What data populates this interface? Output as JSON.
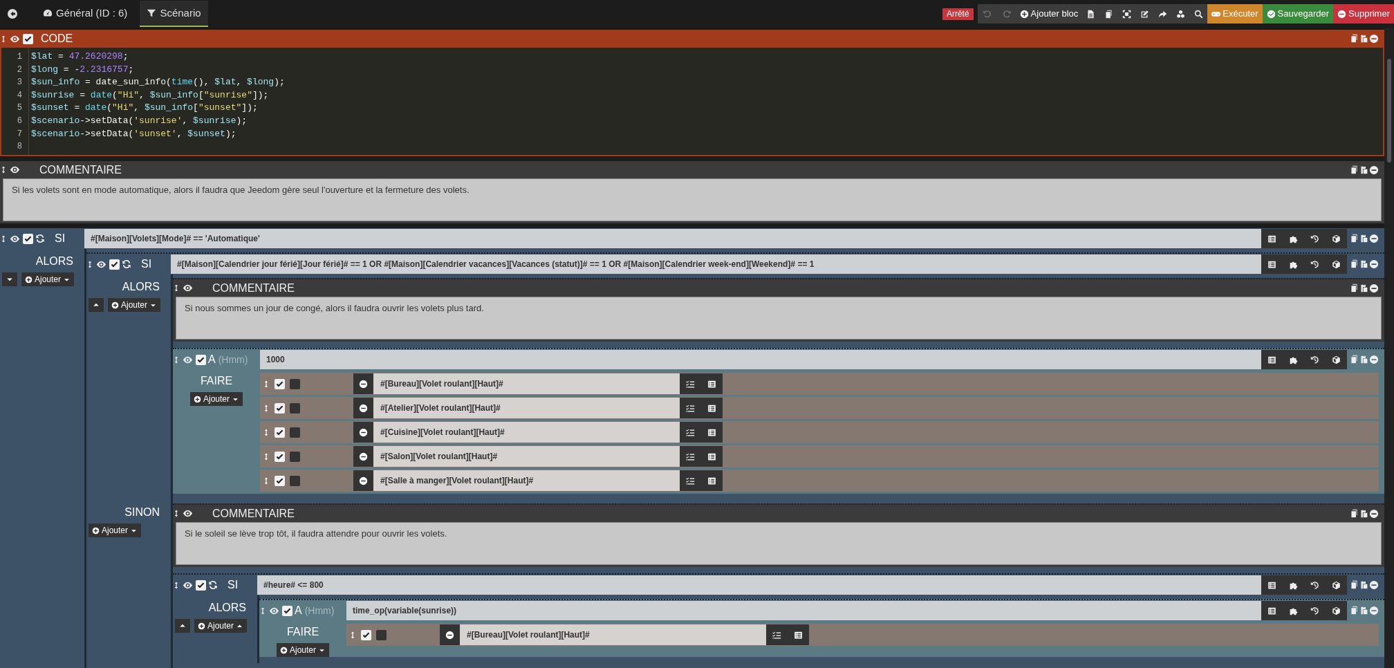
{
  "topbar": {
    "tabs": [
      {
        "label": "Général (ID : 6)",
        "selected": false
      },
      {
        "label": "Scénario",
        "selected": true
      }
    ],
    "status": {
      "label": "Arrêté"
    },
    "undo": {
      "disabled": true
    },
    "redo": {
      "disabled": true
    },
    "add_block": {
      "label": "Ajouter bloc"
    },
    "actions": [
      {
        "label": "Exécuter",
        "color": "#d0862a"
      },
      {
        "label": "Sauvegarder",
        "color": "#3a8b3c"
      },
      {
        "label": "Supprimer",
        "color": "#c9323d"
      }
    ]
  },
  "blocks": [
    {
      "kind": "code",
      "title": "CODE",
      "enabled": true,
      "lines": [
        {
          "number": "1",
          "tokens": [
            {
              "text": "$lat",
              "kind": "var"
            },
            {
              "text": " = ",
              "kind": "plain"
            },
            {
              "text": "47.2620298",
              "kind": "num"
            },
            {
              "text": ";",
              "kind": "plain"
            }
          ]
        },
        {
          "number": "2",
          "tokens": [
            {
              "text": "$long",
              "kind": "var"
            },
            {
              "text": " = -",
              "kind": "plain"
            },
            {
              "text": "2.2316757",
              "kind": "num"
            },
            {
              "text": ";",
              "kind": "plain"
            }
          ]
        },
        {
          "number": "3",
          "tokens": [
            {
              "text": "$sun_info",
              "kind": "var"
            },
            {
              "text": " = date_sun_info(",
              "kind": "plain"
            },
            {
              "text": "time",
              "kind": "fn"
            },
            {
              "text": "(), ",
              "kind": "plain"
            },
            {
              "text": "$lat",
              "kind": "var"
            },
            {
              "text": ", ",
              "kind": "plain"
            },
            {
              "text": "$long",
              "kind": "var"
            },
            {
              "text": ");",
              "kind": "plain"
            }
          ]
        },
        {
          "number": "4",
          "tokens": [
            {
              "text": "$sunrise",
              "kind": "var"
            },
            {
              "text": " = ",
              "kind": "plain"
            },
            {
              "text": "date",
              "kind": "fn"
            },
            {
              "text": "(",
              "kind": "plain"
            },
            {
              "text": "\"Hi\"",
              "kind": "str"
            },
            {
              "text": ", ",
              "kind": "plain"
            },
            {
              "text": "$sun_info",
              "kind": "var"
            },
            {
              "text": "[",
              "kind": "plain"
            },
            {
              "text": "\"sunrise\"",
              "kind": "str"
            },
            {
              "text": "]);",
              "kind": "plain"
            }
          ]
        },
        {
          "number": "5",
          "tokens": [
            {
              "text": "$sunset",
              "kind": "var"
            },
            {
              "text": " = ",
              "kind": "plain"
            },
            {
              "text": "date",
              "kind": "fn"
            },
            {
              "text": "(",
              "kind": "plain"
            },
            {
              "text": "\"Hi\"",
              "kind": "str"
            },
            {
              "text": ", ",
              "kind": "plain"
            },
            {
              "text": "$sun_info",
              "kind": "var"
            },
            {
              "text": "[",
              "kind": "plain"
            },
            {
              "text": "\"sunset\"",
              "kind": "str"
            },
            {
              "text": "]);",
              "kind": "plain"
            }
          ]
        },
        {
          "number": "6",
          "tokens": [
            {
              "text": "$scenario",
              "kind": "var"
            },
            {
              "text": "->setData(",
              "kind": "plain"
            },
            {
              "text": "'sunrise'",
              "kind": "str"
            },
            {
              "text": ", ",
              "kind": "plain"
            },
            {
              "text": "$sunrise",
              "kind": "var"
            },
            {
              "text": ");",
              "kind": "plain"
            }
          ]
        },
        {
          "number": "7",
          "tokens": [
            {
              "text": "$scenario",
              "kind": "var"
            },
            {
              "text": "->setData(",
              "kind": "plain"
            },
            {
              "text": "'sunset'",
              "kind": "str"
            },
            {
              "text": ", ",
              "kind": "plain"
            },
            {
              "text": "$sunset",
              "kind": "var"
            },
            {
              "text": ");",
              "kind": "plain"
            }
          ]
        },
        {
          "number": "8"
        }
      ]
    },
    {
      "kind": "comment",
      "title": "COMMENTAIRE",
      "text": "Si les volets sont en mode automatique, alors il faudra que Jeedom gère seul l'ouverture et la fermeture des volets."
    },
    {
      "kind": "if",
      "label": "SI",
      "enabled": true,
      "condition": "#[Maison][Volets][Mode]# == 'Automatique'",
      "branches": [
        {
          "label": "ALORS",
          "expanded": false,
          "add": {
            "label": "Ajouter",
            "menu_open": false
          },
          "children": [
            {
              "kind": "if",
              "label": "SI",
              "enabled": true,
              "condition": "#[Maison][Calendrier jour férié][Jour férié]# == 1 OR #[Maison][Calendrier vacances][Vacances (statut)]# == 1 OR #[Maison][Calendrier week-end][Weekend]# == 1",
              "branches": [
                {
                  "label": "ALORS",
                  "expanded": true,
                  "add": {
                    "label": "Ajouter",
                    "menu_open": false
                  },
                  "children": [
                    {
                      "kind": "comment",
                      "title": "COMMENTAIRE",
                      "text": "Si nous sommes un jour de congé, alors il faudra ouvrir les volets plus tard."
                    },
                    {
                      "kind": "at",
                      "label": "A",
                      "unit": "(Hmm)",
                      "enabled": true,
                      "value": "1000",
                      "section": "FAIRE",
                      "add": {
                        "label": "Ajouter",
                        "menu_open": false
                      },
                      "actions": [
                        {
                          "value": "#[Bureau][Volet roulant][Haut]#",
                          "enabled": true,
                          "parallel": false
                        },
                        {
                          "value": "#[Atelier][Volet roulant][Haut]#",
                          "enabled": true,
                          "parallel": false
                        },
                        {
                          "value": "#[Cuisine][Volet roulant][Haut]#",
                          "enabled": true,
                          "parallel": false
                        },
                        {
                          "value": "#[Salon][Volet roulant][Haut]#",
                          "enabled": true,
                          "parallel": false
                        },
                        {
                          "value": "#[Salle à manger][Volet roulant][Haut]#",
                          "enabled": true,
                          "parallel": false
                        }
                      ]
                    }
                  ]
                },
                {
                  "label": "SINON",
                  "add": {
                    "label": "Ajouter",
                    "menu_open": false
                  },
                  "children": [
                    {
                      "kind": "comment",
                      "title": "COMMENTAIRE",
                      "text": "Si le soleil se lève trop tôt, il faudra attendre pour ouvrir les volets."
                    },
                    {
                      "kind": "if",
                      "label": "SI",
                      "enabled": true,
                      "condition": "#heure# <= 800",
                      "branches": [
                        {
                          "label": "ALORS",
                          "expanded": true,
                          "add": {
                            "label": "Ajouter",
                            "menu_open": true
                          },
                          "children": [
                            {
                              "kind": "at",
                              "label": "A",
                              "unit": "(Hmm)",
                              "enabled": true,
                              "value": "time_op(variable(sunrise))",
                              "section": "FAIRE",
                              "add": {
                                "label": "Ajouter",
                                "menu_open": false
                              },
                              "actions": [
                                {
                                  "value": "#[Bureau][Volet roulant][Haut]#",
                                  "enabled": true,
                                  "parallel": false
                                }
                              ]
                            }
                          ]
                        }
                      ]
                    }
                  ]
                }
              ]
            }
          ]
        }
      ]
    }
  ]
}
